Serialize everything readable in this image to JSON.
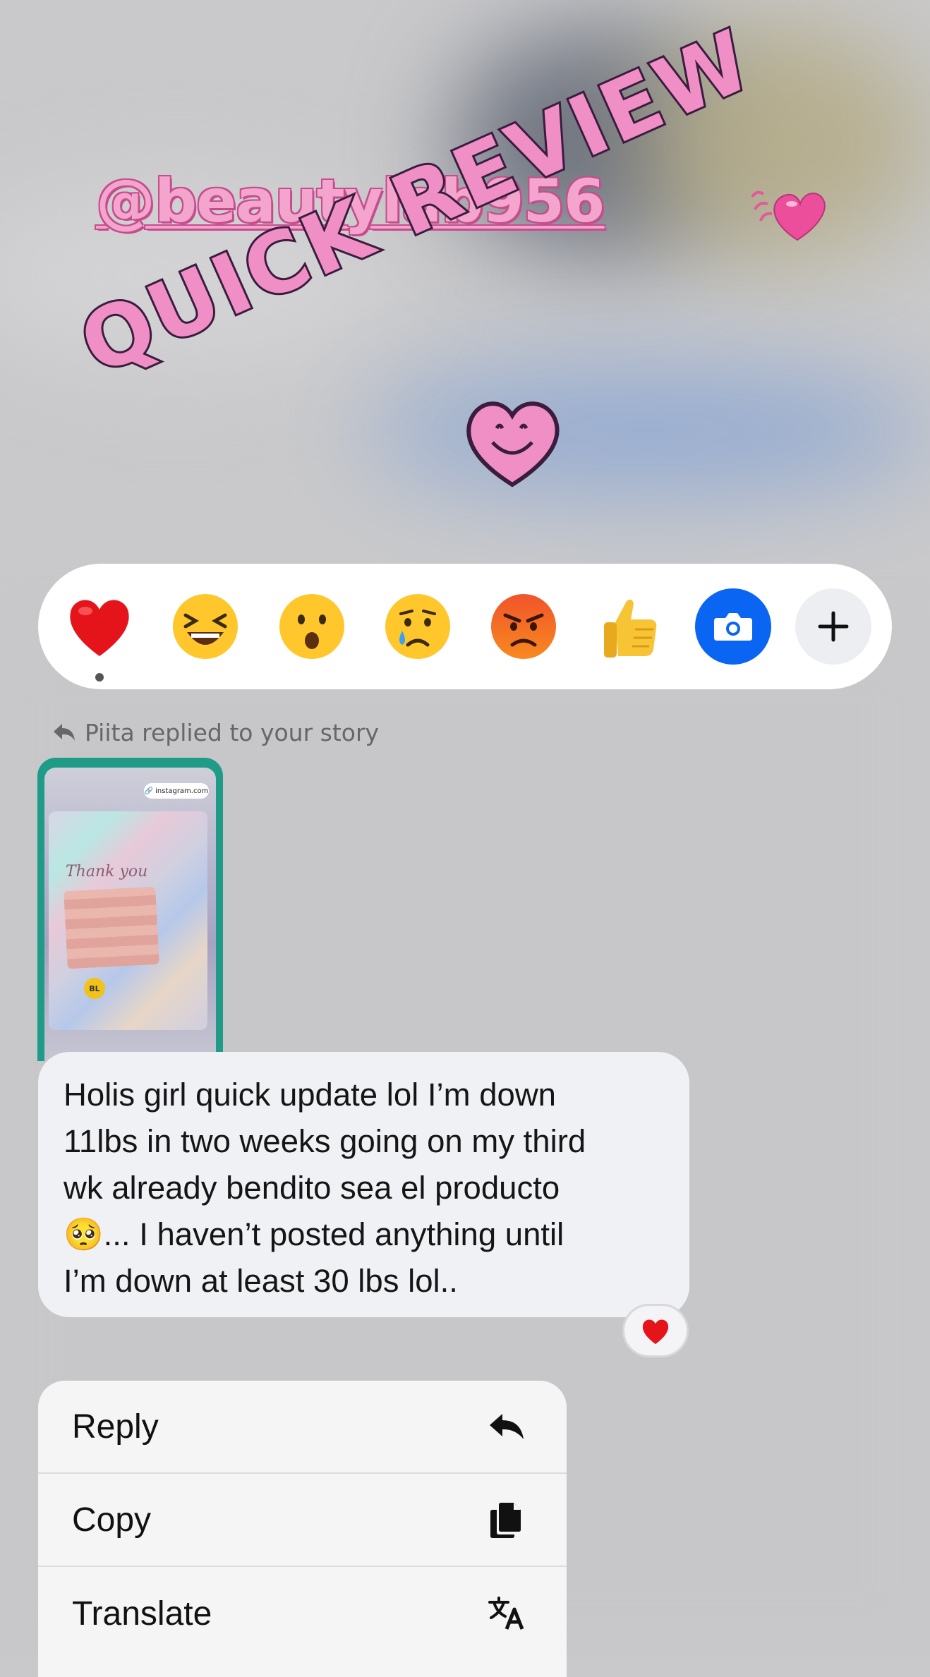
{
  "story_overlay": {
    "handle": "@beautylab956",
    "headline": "QUICK REVIEW"
  },
  "reactions": [
    {
      "name": "heart",
      "selected": true
    },
    {
      "name": "laughing"
    },
    {
      "name": "surprised"
    },
    {
      "name": "crying"
    },
    {
      "name": "angry"
    },
    {
      "name": "thumbs-up"
    },
    {
      "name": "camera"
    },
    {
      "name": "more"
    }
  ],
  "reply_header": "Piita replied to your story",
  "story_thumbnail": {
    "link_badge": "instagram.com",
    "sticker_text": "Thank you",
    "badge": "BL"
  },
  "message": {
    "text": "Holis girl quick update lol I’m down\n11lbs in  two weeks going on my third\nwk already bendito sea el producto\n🥺... I haven’t posted anything until\nI’m down at least 30 lbs lol..",
    "reaction": "❤️"
  },
  "menu": {
    "items": [
      {
        "label": "Reply",
        "icon": "reply-icon"
      },
      {
        "label": "Copy",
        "icon": "copy-icon"
      },
      {
        "label": "Translate",
        "icon": "translate-icon"
      }
    ]
  },
  "colors": {
    "accent_blue": "#0a66f2",
    "story_pink": "#f08fc6",
    "thumb_border": "#1f9b88"
  }
}
